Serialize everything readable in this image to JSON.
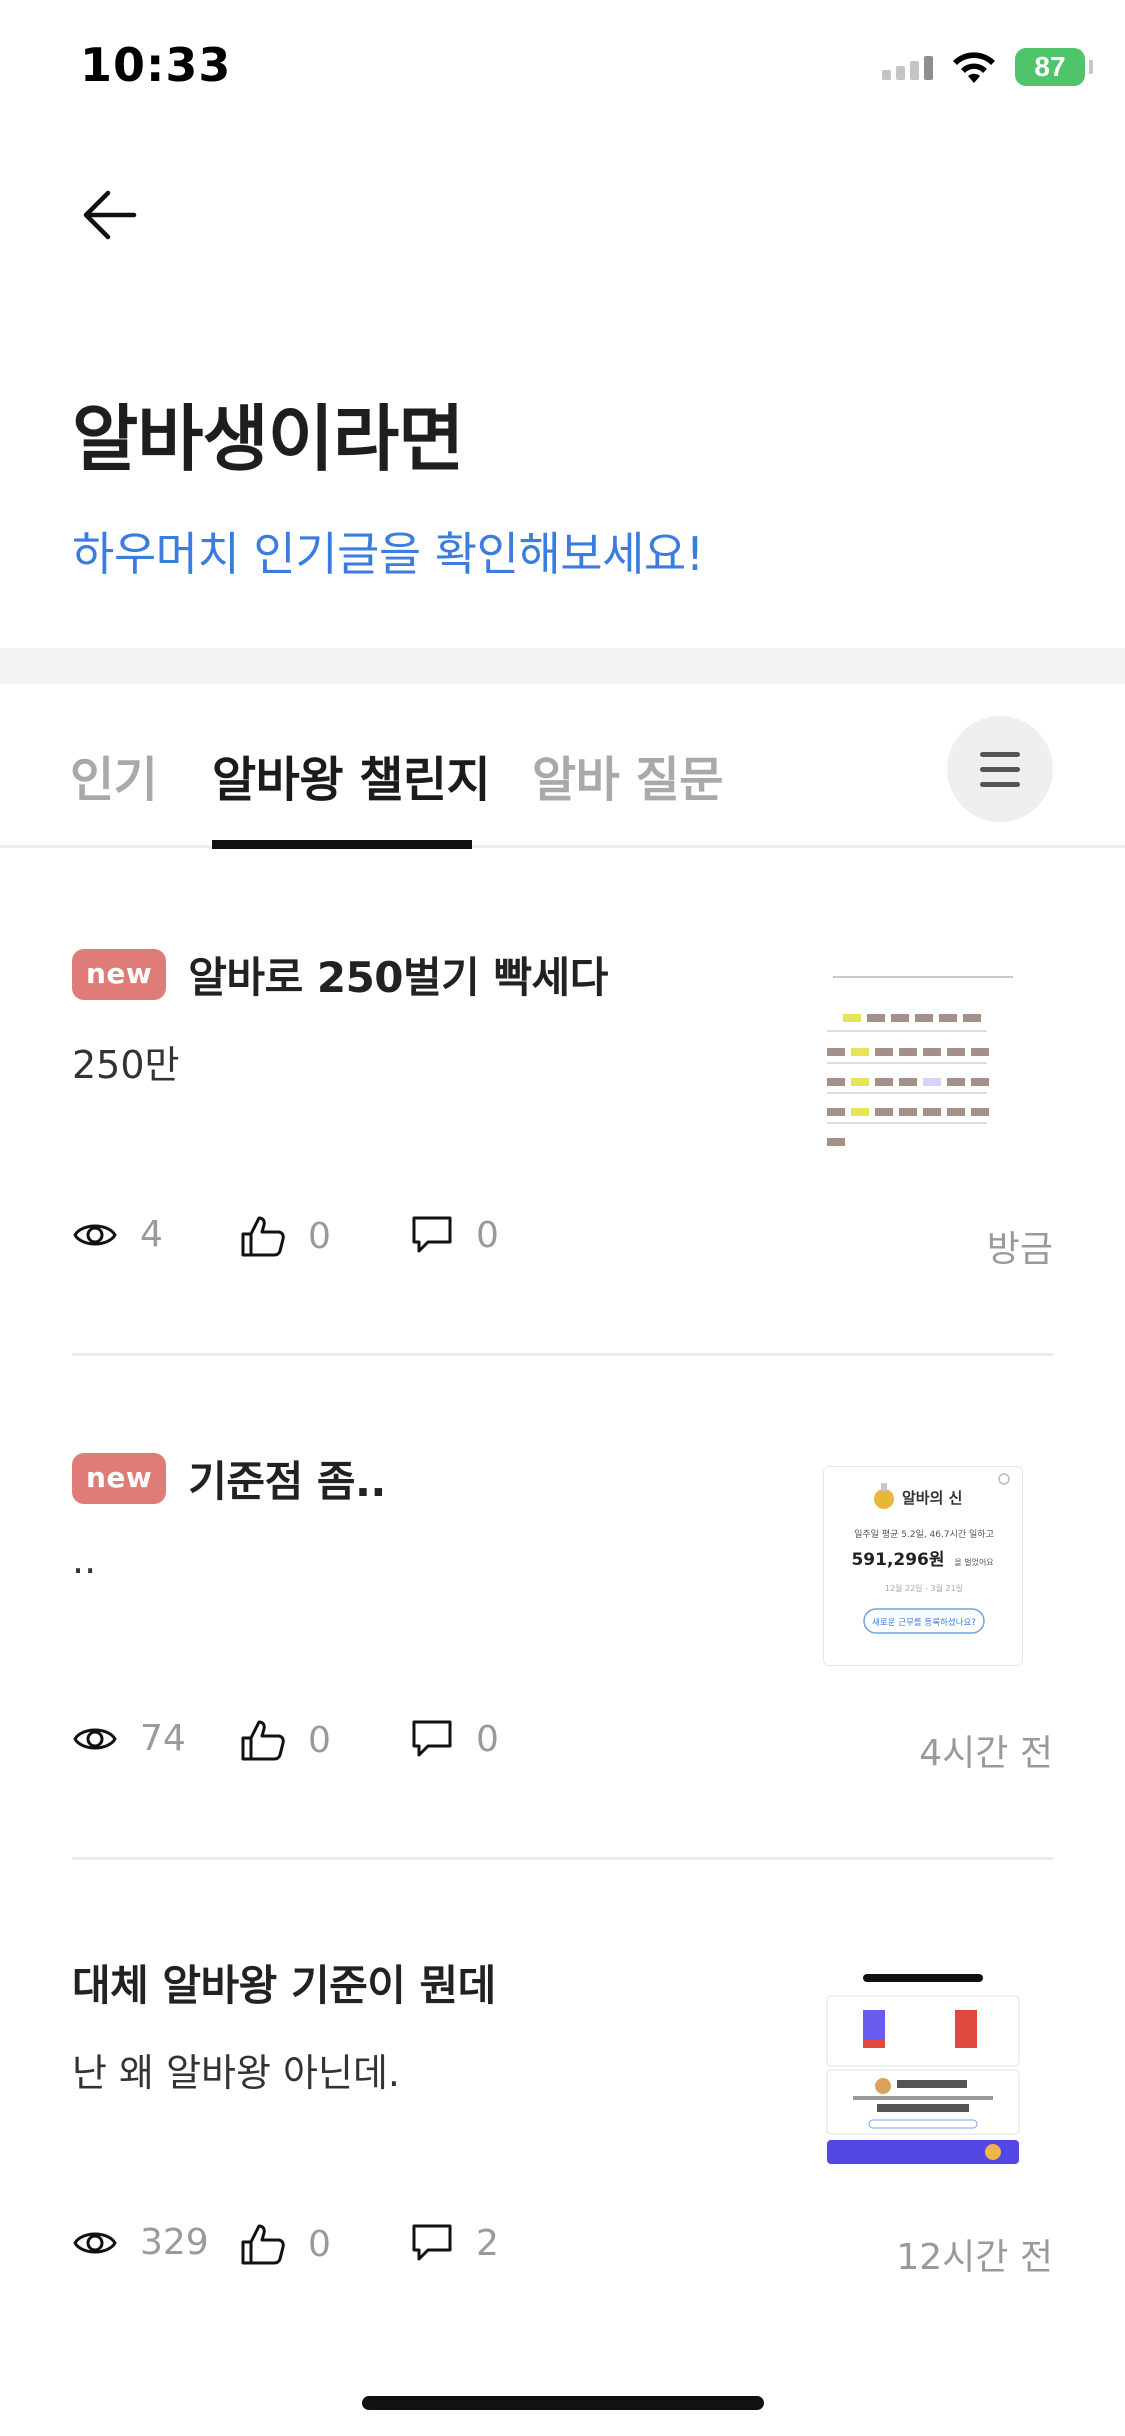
{
  "status_bar": {
    "time": "10:33",
    "battery": "87"
  },
  "header": {
    "back_icon": "arrow-left-icon",
    "title": "알바생이라면",
    "subtitle": "하우머치 인기글을 확인해보세요!"
  },
  "tabs": {
    "items": [
      {
        "label": "인기"
      },
      {
        "label": "알바왕 챌린지"
      },
      {
        "label": "알바 질문"
      }
    ],
    "active_index": 1,
    "menu_icon": "hamburger-menu-icon"
  },
  "posts": [
    {
      "badge": "new",
      "title": "알바로 250벌기 빡세다",
      "body": "250만",
      "views": "4",
      "likes": "0",
      "comments": "0",
      "time": "방금",
      "thumbnail": "calendar-screenshot"
    },
    {
      "badge": "new",
      "title": "기준점 좀..",
      "body": "..",
      "views": "74",
      "likes": "0",
      "comments": "0",
      "time": "4시간 전",
      "thumbnail": "albaui-sin-card",
      "thumb_text": {
        "name": "알바의 신",
        "line1": "일주일 평균 5.2일, 46.7시간 일하고",
        "amount": "591,296원",
        "amount_unit": "을 벌었어요",
        "range": "12월 22일 - 3월 21일",
        "button": "새로운 근무를 등록하셨나요?"
      }
    },
    {
      "badge": "",
      "title": "대체 알바왕 기준이 뭔데",
      "body": "난 왜 알바왕 아닌데.",
      "views": "329",
      "likes": "0",
      "comments": "2",
      "time": "12시간 전",
      "thumbnail": "app-stats-screenshot"
    }
  ],
  "colors": {
    "accent_blue": "#3b7ddd",
    "new_badge": "#e07c78",
    "muted": "#9a9a9a",
    "band": "#f2f3f5"
  }
}
